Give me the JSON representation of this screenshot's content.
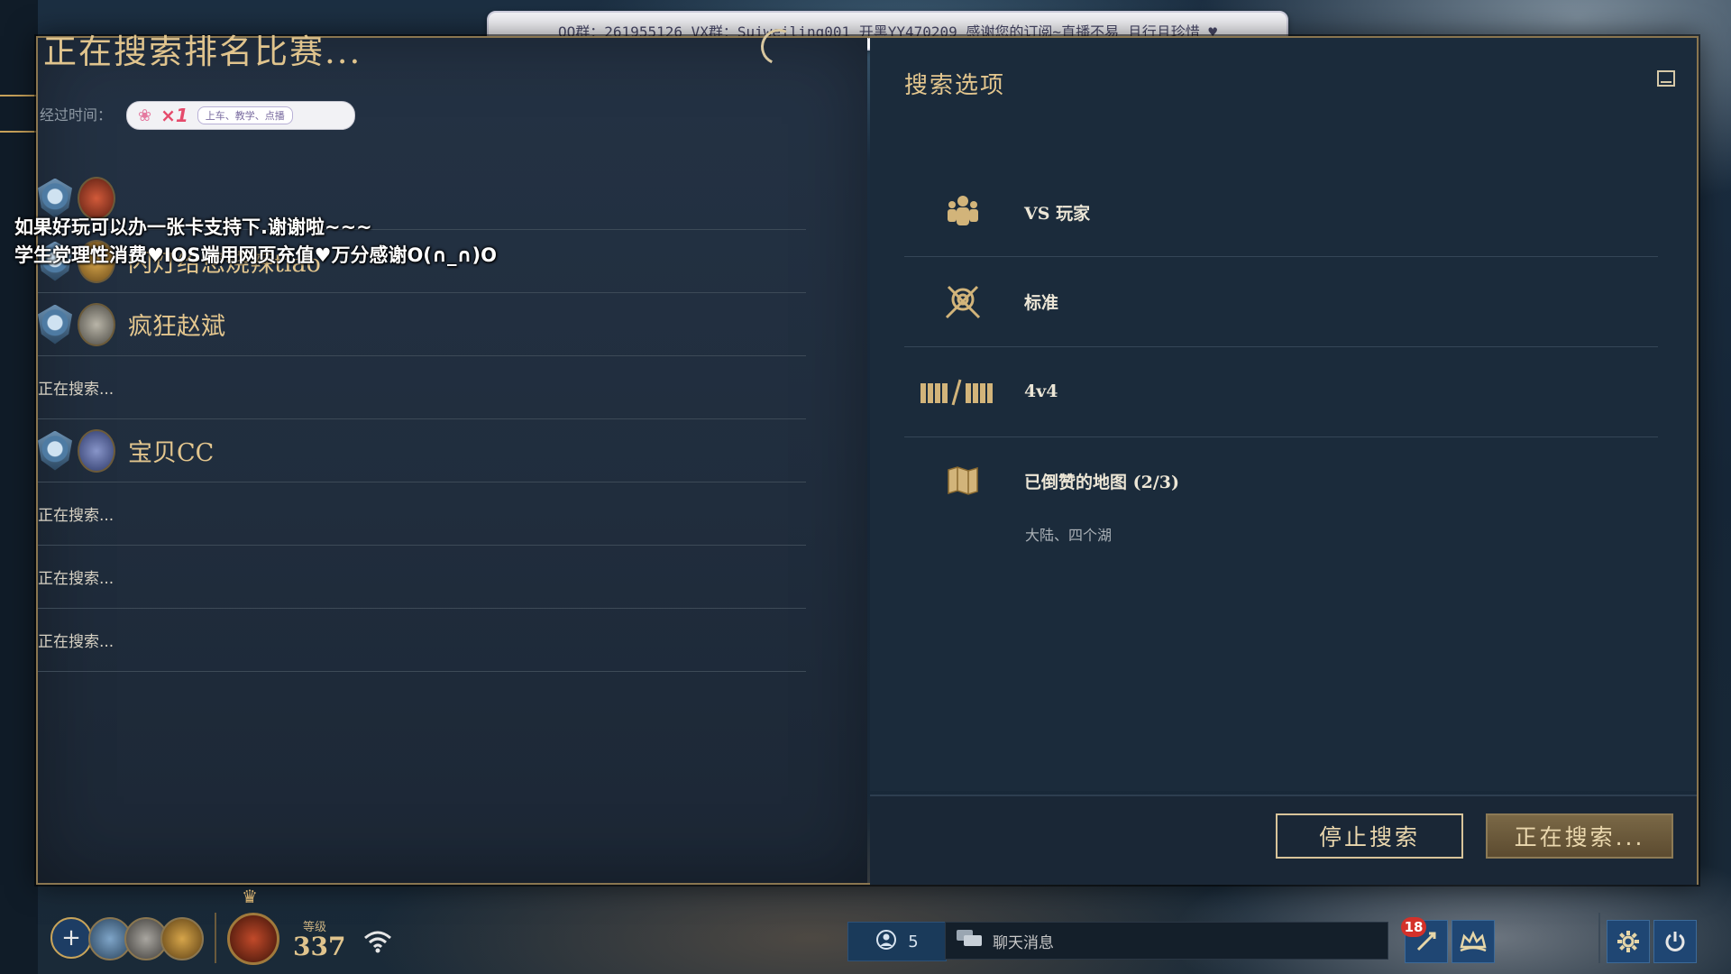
{
  "banner": {
    "text": "QQ群：261955126 VX群：Suiweiling001 开黑YY470209 感谢您的订阅~直播不易 且行且珍惜 ♥"
  },
  "search": {
    "title": "正在搜索排名比赛...",
    "elapsed_label": "经过时间：",
    "badge_multiplier": "×1",
    "badge_sub": "上车、教学、点播"
  },
  "stream_overlay": {
    "line1": "如果好玩可以办一张卡支持下.谢谢啦~~~",
    "line2": "学生党理性消费♥IOS端用网页充值♥万分感谢O(∩_∩)O"
  },
  "players": [
    {
      "name": "",
      "avatar": "red"
    },
    {
      "name": "闪灯给您烧辣tiao",
      "avatar": "gold"
    },
    {
      "name": "疯狂赵斌",
      "avatar": "gray"
    },
    {
      "name": "宝贝CC",
      "avatar": "purple"
    }
  ],
  "searching_label": "正在搜索...",
  "options": {
    "title": "搜索选项",
    "items": [
      {
        "label": "VS 玩家",
        "icon": "players-icon"
      },
      {
        "label": "标准",
        "icon": "standard-mode-icon"
      },
      {
        "label": "4v4",
        "icon": "team-size-icon"
      },
      {
        "label": "已倒赞的地图 (2/3)",
        "icon": "map-scroll-icon"
      }
    ],
    "maps_detail": "大陆、四个湖"
  },
  "buttons": {
    "stop": "停止搜索",
    "searching": "正在搜索..."
  },
  "footer": {
    "level_label": "等级",
    "level_value": "337",
    "friends_count": "5",
    "chat_placeholder": "聊天消息",
    "notifications": "18"
  }
}
